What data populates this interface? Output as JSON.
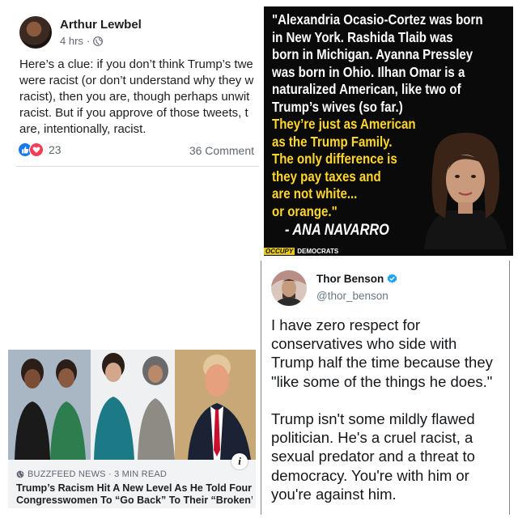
{
  "fb_post": {
    "author": "Arthur Lewbel",
    "time": "4 hrs",
    "separator": "·",
    "privacy_icon": "globe-icon",
    "text_lines": [
      "Here’s a clue: if you don’t think Trump’s twe",
      "were racist (or don’t understand why they w",
      "racist), then you are, though perhaps unwit",
      "racist. But if you approve of those tweets, t",
      "are, intentionally, racist."
    ],
    "reaction_icons": [
      "like-icon",
      "love-icon"
    ],
    "reaction_count": "23",
    "comments": "36 Comment"
  },
  "quote_card": {
    "white_lines": [
      "\"Alexandria Ocasio-Cortez was born",
      "in New York. Rashida Tlaib was",
      "born in Michigan. Ayanna Pressley",
      "was born in Ohio. Ilhan Omar is a",
      "naturalized American, like two of",
      "Trump’s wives (so far.)"
    ],
    "yellow_lines": [
      "They’re just as American",
      "as the Trump Family.",
      "The only difference is",
      "they pay taxes and",
      "are not white...",
      "or orange.\""
    ],
    "attribution": "- ANA NAVARRO",
    "logo_part1": "OCCUPY",
    "logo_part2": "DEMOCRATS",
    "colors": {
      "background": "#0a0a0a",
      "highlight": "#ffd62a"
    }
  },
  "buzzfeed_card": {
    "source": "BUZZFEED NEWS · 3 MIN READ",
    "source_icon": "globe-icon",
    "headline_lines": [
      "Trump’s Racism Hit A New Level As He Told Four",
      "Congresswomen To “Go Back” To Their “Broken”..."
    ],
    "info_label": "i"
  },
  "tweet": {
    "name": "Thor Benson",
    "handle": "@thor_benson",
    "verified_icon": "verified-badge-icon",
    "paragraph1_lines": [
      "I have zero respect for",
      "conservatives who side with",
      "Trump half the time because they",
      "\"like some of the things he does.\""
    ],
    "paragraph2_lines": [
      "Trump isn't some mildly flawed",
      "politician. He's a cruel racist, a",
      "sexual predator and a threat to",
      "democracy. You're with him or",
      "you're against him."
    ]
  }
}
